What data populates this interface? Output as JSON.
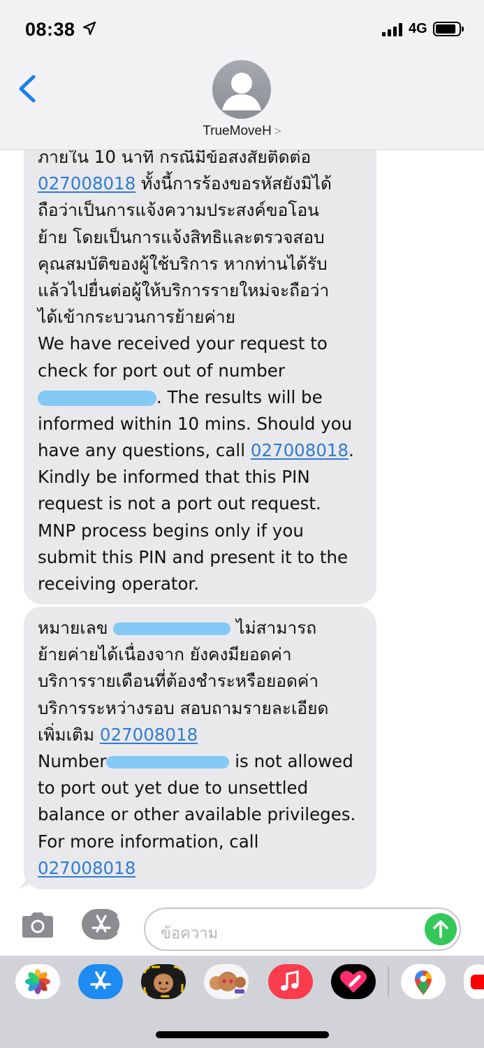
{
  "status_bar": {
    "time": "08:38",
    "network": "4G"
  },
  "header": {
    "contact_name": "TrueMoveH",
    "contact_chevron": ">"
  },
  "message1": {
    "lines": [
      "ภายใน 10 นาที กรณีมีข้อสงสัยติดต่อ",
      null,
      "ถือว่าเป็นการแจ้งความประสงค์ขอโอน",
      "ย้าย โดยเป็นการแจ้งสิทธิและตรวจสอบ",
      "คุณสมบัติของผู้ใช้บริการ หากท่านได้รับ",
      "แล้วไปยื่นต่อผู้ให้บริการรายใหม่จะถือว่า",
      "ได้เข้ากระบวนการย้ายค่าย",
      "We have received your request to",
      "check for port out of number",
      null,
      "informed within 10 mins. Should you",
      null,
      "Kindly be informed that this PIN",
      "request is not a port out request.",
      "MNP process begins only if you",
      "submit this PIN and present it to the",
      "receiving operator."
    ],
    "line2_link": "027008018",
    "line2_text": " ทั้งนี้การร้องขอรหัสยังมิได้",
    "line10_text": ". The results will be",
    "line12_text": "have any questions, call ",
    "line12_link": "027008018",
    "line12_end": "."
  },
  "message2": {
    "line1_start": "หมายเลข ",
    "line1_end": " ไม่สามารถ",
    "line2": "ย้ายค่ายได้เนื่องจาก ยังคงมียอดค่า",
    "line3": "บริการรายเดือนที่ต้องชำระหรือยอดค่า",
    "line4": "บริการระหว่างรอบ สอบถามรายละเอียด",
    "line5_start": "เพิ่มเติม ",
    "line5_link": "027008018",
    "line6_start": "Number",
    "line6_end": " is not allowed",
    "line7": "to port out yet due to unsettled",
    "line8": "balance or other available privileges.",
    "line9": "For more information, call",
    "line10_link": "027008018"
  },
  "input": {
    "placeholder": "ข้อความ"
  },
  "colors": {
    "link": "#2f7bd6",
    "bubble": "#e9e9eb",
    "send": "#34c759",
    "redaction": "#7ec7f3"
  },
  "app_drawer": [
    "photos-icon",
    "app-store-icon",
    "memoji-icon",
    "memoji-stickers-icon",
    "music-icon",
    "digital-touch-icon",
    "google-maps-icon",
    "youtube-icon"
  ]
}
